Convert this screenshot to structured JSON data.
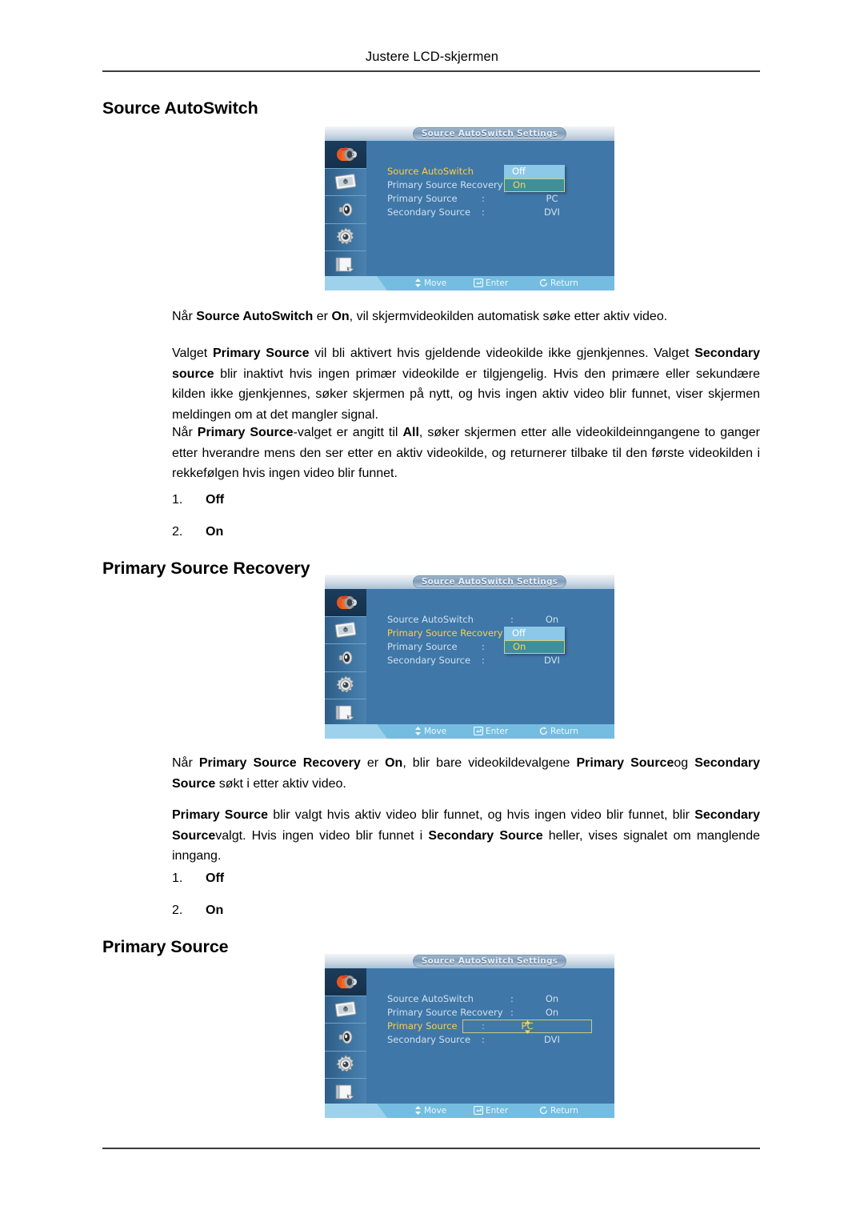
{
  "running_head": "Justere LCD-skjermen",
  "sections": [
    {
      "heading": "Source AutoSwitch",
      "paragraphs": [
        [
          {
            "t": "Når ",
            "b": false
          },
          {
            "t": "Source AutoSwitch",
            "b": true
          },
          {
            "t": " er ",
            "b": false
          },
          {
            "t": "On",
            "b": true
          },
          {
            "t": ", vil skjermvideokilden automatisk søke etter aktiv video.",
            "b": false
          }
        ],
        [
          {
            "t": "Valget ",
            "b": false
          },
          {
            "t": "Primary Source",
            "b": true
          },
          {
            "t": " vil bli aktivert hvis gjeldende videokilde ikke gjenkjennes. Valget ",
            "b": false
          },
          {
            "t": "Secondary source",
            "b": true
          },
          {
            "t": " blir inaktivt hvis ingen primær videokilde er tilgjengelig. Hvis den primære eller sekundære kilden ikke gjenkjennes, søker skjermen på nytt, og hvis ingen aktiv video blir funnet, viser skjermen meldingen om at det mangler signal.",
            "b": false
          }
        ],
        [
          {
            "t": "Når ",
            "b": false
          },
          {
            "t": "Primary Source",
            "b": true
          },
          {
            "t": "-valget er angitt til ",
            "b": false
          },
          {
            "t": "All",
            "b": true
          },
          {
            "t": ", søker skjermen etter alle videokildeinngangene to ganger etter hverandre mens den ser etter en aktiv videokilde, og returnerer tilbake til den første videokilden i rekkefølgen hvis ingen video blir funnet.",
            "b": false
          }
        ]
      ],
      "list": [
        {
          "num": "1.",
          "label": "Off"
        },
        {
          "num": "2.",
          "label": "On"
        }
      ]
    },
    {
      "heading": "Primary Source Recovery",
      "paragraphs": [
        [
          {
            "t": "Når ",
            "b": false
          },
          {
            "t": "Primary Source Recovery",
            "b": true
          },
          {
            "t": " er ",
            "b": false
          },
          {
            "t": "On",
            "b": true
          },
          {
            "t": ", blir bare videokildevalgene ",
            "b": false
          },
          {
            "t": "Primary Source",
            "b": true
          },
          {
            "t": "og ",
            "b": false
          },
          {
            "t": "Secondary Source",
            "b": true
          },
          {
            "t": " søkt i etter aktiv video.",
            "b": false
          }
        ],
        [
          {
            "t": "Primary Source",
            "b": true
          },
          {
            "t": " blir valgt hvis aktiv video blir funnet, og hvis ingen video blir funnet, blir ",
            "b": false
          },
          {
            "t": "Secondary Source",
            "b": true
          },
          {
            "t": "valgt. Hvis ingen video blir funnet i ",
            "b": false
          },
          {
            "t": "Secondary Source",
            "b": true
          },
          {
            "t": " heller, vises signalet om manglende inngang.",
            "b": false
          }
        ]
      ],
      "list": [
        {
          "num": "1.",
          "label": "Off"
        },
        {
          "num": "2.",
          "label": "On"
        }
      ]
    },
    {
      "heading": "Primary Source",
      "paragraphs": [],
      "list": []
    }
  ],
  "osd": {
    "title": "Source AutoSwitch Settings",
    "sidebar_icons": [
      "input-source-icon",
      "picture-screen-icon",
      "speaker-sound-icon",
      "gear-setup-icon",
      "multi-control-icon"
    ],
    "guide": [
      {
        "icon": "up-down-arrow-icon",
        "label": "Move"
      },
      {
        "icon": "enter-key-icon",
        "label": "Enter"
      },
      {
        "icon": "return-arrow-icon",
        "label": "Return"
      }
    ],
    "colors": {
      "panel_bg": "#3f77a8",
      "label": "#cfe0ee",
      "label_active": "#ffcf45",
      "option_plain_bg": "#8cc8e8",
      "option_highlight_bg": "#3f8f99",
      "option_highlight_text": "#ffd34d",
      "highlight_border": "#cfd27a",
      "guide_bar": "#74bde0"
    },
    "screens": [
      {
        "id": "osd-source-autoswitch",
        "active_row": 0,
        "rows": [
          {
            "label": "Source AutoSwitch",
            "colon": ":",
            "value": ""
          },
          {
            "label": "Primary Source Recovery",
            "colon": ":",
            "value": ""
          },
          {
            "label": "Primary Source",
            "colon": ":",
            "value": "PC"
          },
          {
            "label": "Secondary Source",
            "colon": ":",
            "value": "DVI"
          }
        ],
        "popup": {
          "top": 0,
          "options": [
            {
              "label": "Off",
              "state": "plain"
            },
            {
              "label": "On",
              "state": "highlight"
            }
          ]
        },
        "selbar": null
      },
      {
        "id": "osd-primary-source-recovery",
        "active_row": 1,
        "rows": [
          {
            "label": "Source AutoSwitch",
            "colon": ":",
            "value": "On"
          },
          {
            "label": "Primary Source Recovery",
            "colon": ":",
            "value": ""
          },
          {
            "label": "Primary Source",
            "colon": ":",
            "value": ""
          },
          {
            "label": "Secondary Source",
            "colon": ":",
            "value": "DVI"
          }
        ],
        "popup": {
          "top": 1,
          "options": [
            {
              "label": "Off",
              "state": "plain"
            },
            {
              "label": "On",
              "state": "highlight"
            }
          ]
        },
        "selbar": null
      },
      {
        "id": "osd-primary-source",
        "active_row": 2,
        "rows": [
          {
            "label": "Source AutoSwitch",
            "colon": ":",
            "value": "On"
          },
          {
            "label": "Primary Source Recovery",
            "colon": ":",
            "value": "On"
          },
          {
            "label": "Primary Source",
            "colon": ":",
            "value": ""
          },
          {
            "label": "Secondary Source",
            "colon": ":",
            "value": "DVI"
          }
        ],
        "popup": null,
        "selbar": {
          "row": 2,
          "value": "PC"
        }
      }
    ]
  }
}
